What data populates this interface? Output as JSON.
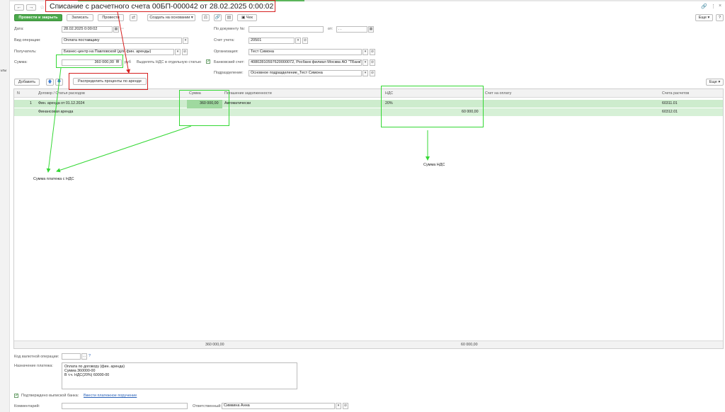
{
  "left_fragment": "ьты",
  "window": {
    "title": "Списание с расчетного счета 00БП-000042 от 28.02.2025 0:00:02",
    "link_icon": "link-icon",
    "more_icon": "more-vertical-icon",
    "close_icon": "close-icon"
  },
  "nav": {
    "back_icon": "arrow-left-icon",
    "forward_icon": "arrow-right-icon",
    "star_icon": "star-icon"
  },
  "toolbar": {
    "post_close": "Провести и закрыть",
    "save": "Записать",
    "post": "Провести",
    "create_based": "Создать на основании",
    "check": "Чек",
    "more": "Еще",
    "help": "?"
  },
  "form": {
    "date_label": "Дата:",
    "date_value": "28.02.2025  0:00:02",
    "doc_no_label": "По документу №:",
    "doc_no_value": "",
    "from_label": "от:",
    "from_value": ". .",
    "op_type_label": "Вид операции:",
    "op_type_value": "Оплата поставщику",
    "account_label": "Счет учета:",
    "account_value": "20501",
    "recipient_label": "Получатель:",
    "recipient_value": "Бизнес-центр на Павловской (для фин. аренды)",
    "org_label": "Организация:",
    "org_value": "Тест Симона",
    "sum_label": "Сумма:",
    "sum_value": "360 000,00",
    "currency": "руб",
    "vat_separate_label": "Выделять НДС в отдельную статью",
    "vat_separate_checked": true,
    "bank_label": "Банковский счет:",
    "bank_value": "40802810597620000072, Росбанк филиал Москва АО \"ТБанк\"",
    "division_label": "Подразделение:",
    "division_value": "Основное подразделение_Тест Симона",
    "distribute_button": "Распределить проценты по аренде"
  },
  "table_toolbar": {
    "add": "Добавить",
    "more": "Еще"
  },
  "table": {
    "columns": [
      "N",
      "Договор / Статья расходов",
      "Сумма",
      "Погашение задолженности",
      "НДС",
      "Счет на оплату",
      "Счета расчетов"
    ],
    "rows": [
      {
        "n": "1",
        "contract": "Фин. аренда от 01.12.2024",
        "sum": "360 000,00",
        "repayment": "Автоматически",
        "vat_rate": "20%",
        "invoice": "",
        "account": "60311.01"
      },
      {
        "n": "",
        "contract": "Финансовая аренда",
        "sum": "",
        "repayment": "",
        "vat_amount": "60 000,00",
        "invoice": "",
        "account": "60312.01"
      }
    ],
    "footer_sum": "360 000,00",
    "footer_vat": "60 000,00"
  },
  "bottom": {
    "currency_op_label": "Код валютной операции:",
    "currency_op_value": "",
    "purpose_label": "Назначение платежа:",
    "purpose_lines": [
      "Оплата по договору (фин. аренда)",
      "Сумма 360000-00",
      "В т.ч. НДС(20%) 60000-00"
    ],
    "bank_confirmed_label": "Подтверждено выпиской банка:",
    "bank_confirmed_checked": true,
    "enter_order_link": "Ввести платежное поручение",
    "comment_label": "Комментарий:",
    "comment_value": "",
    "responsible_label": "Ответственный:",
    "responsible_value": "Симкина Анна"
  },
  "annotations": {
    "payment_with_vat": "Сумма платежа с НДС",
    "vat_sum": "Сумма НДС"
  },
  "colors": {
    "accent_green": "#4aa84a",
    "row_green": "#d6f0d6",
    "annot_green": "#34d834",
    "annot_red": "#d62020"
  }
}
